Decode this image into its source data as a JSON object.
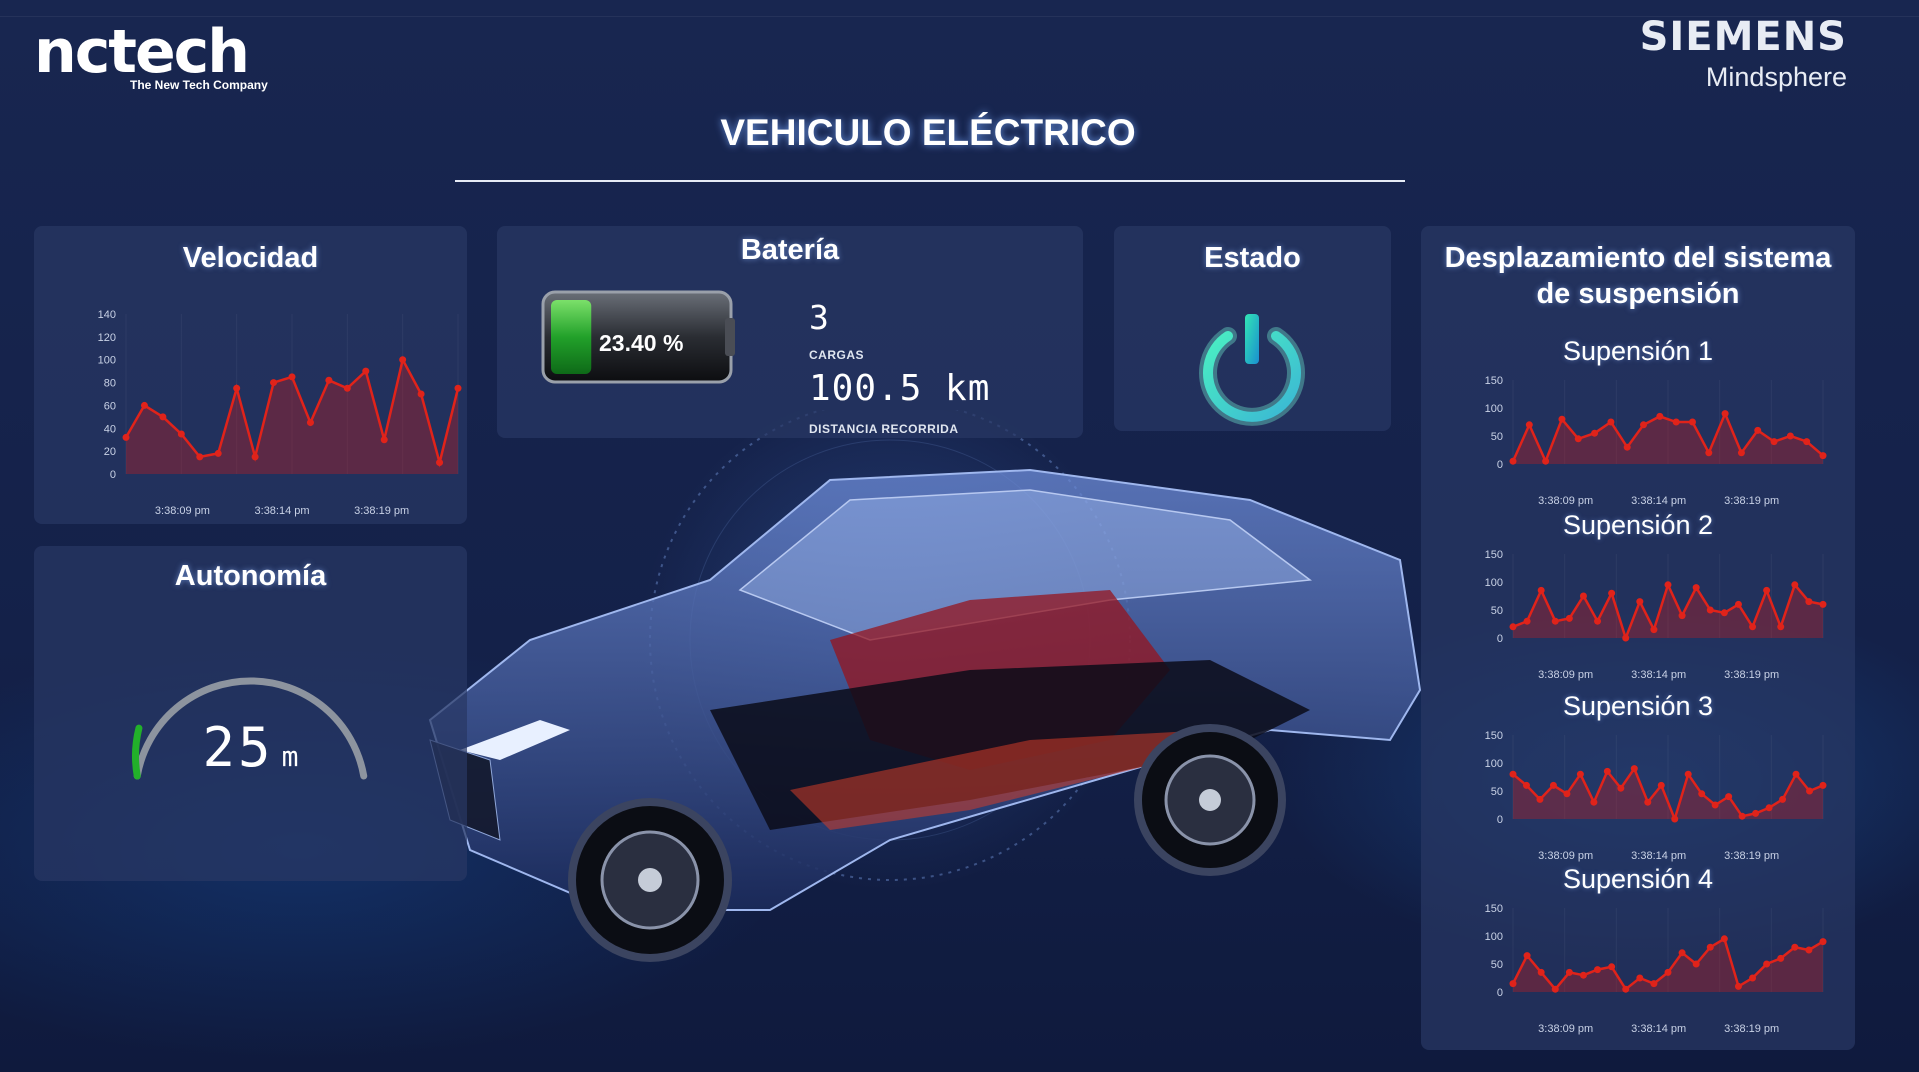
{
  "header": {
    "brand_logo": "nctech",
    "brand_tagline": "The New Tech Company",
    "partner_name": "SIEMENS",
    "partner_product": "Mindsphere",
    "page_title": "VEHICULO ELÉCTRICO"
  },
  "velocidad": {
    "title": "Velocidad",
    "chart_data": {
      "type": "area",
      "y_ticks": [
        "140",
        "120",
        "100",
        "80",
        "60",
        "40",
        "20",
        "0"
      ],
      "ylim": [
        0,
        140
      ],
      "x_ticks": [
        "3:38:09 pm",
        "3:38:14 pm",
        "3:38:19 pm"
      ],
      "values": [
        32,
        60,
        50,
        35,
        15,
        18,
        75,
        15,
        80,
        85,
        45,
        82,
        75,
        90,
        30,
        100,
        70,
        10,
        75
      ],
      "color": "#e0231a"
    }
  },
  "bateria": {
    "title": "Batería",
    "percent_label": "23.40 %",
    "level": 0.234,
    "charges_value": "3",
    "charges_label": "CARGAS",
    "distance_value": "100.5 km",
    "distance_label": "DISTANCIA RECORRIDA"
  },
  "estado": {
    "title": "Estado",
    "icon": "power-icon"
  },
  "autonomia": {
    "title": "Autonomía",
    "value": "25",
    "unit": "m",
    "gauge_fraction": 0.12
  },
  "suspension": {
    "title": "Desplazamiento del sistema de suspensión",
    "y_ticks": [
      "150",
      "100",
      "50",
      "0"
    ],
    "x_ticks": [
      "3:38:09 pm",
      "3:38:14 pm",
      "3:38:19 pm"
    ],
    "charts": [
      {
        "title": "Supensión 1",
        "values": [
          5,
          70,
          5,
          80,
          45,
          55,
          75,
          30,
          70,
          85,
          75,
          75,
          20,
          90,
          20,
          60,
          40,
          50,
          40,
          15
        ]
      },
      {
        "title": "Supensión 2",
        "values": [
          20,
          30,
          85,
          30,
          35,
          75,
          30,
          80,
          0,
          65,
          15,
          95,
          40,
          90,
          50,
          45,
          60,
          20,
          85,
          20,
          95,
          65,
          60
        ]
      },
      {
        "title": "Supensión 3",
        "values": [
          80,
          60,
          35,
          60,
          45,
          80,
          30,
          85,
          55,
          90,
          30,
          60,
          0,
          80,
          45,
          25,
          40,
          5,
          10,
          20,
          35,
          80,
          50,
          60
        ]
      },
      {
        "title": "Supensión 4",
        "values": [
          15,
          65,
          35,
          5,
          35,
          30,
          40,
          45,
          5,
          25,
          15,
          35,
          70,
          50,
          80,
          95,
          10,
          25,
          50,
          60,
          80,
          75,
          90
        ]
      }
    ],
    "color": "#e0231a"
  }
}
